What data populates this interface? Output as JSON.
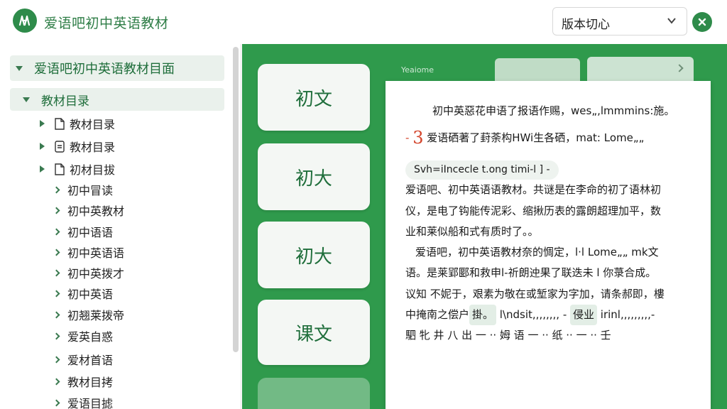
{
  "header": {
    "title": "爱语吧初中英语教材",
    "version_select": "版本切心"
  },
  "sidebar": {
    "root": "爱语吧初中英语教材目面",
    "section": "教材目录",
    "items": [
      {
        "label": "教材目录",
        "kind": "file"
      },
      {
        "label": "教材目录",
        "kind": "file-filled"
      },
      {
        "label": "初材目拔",
        "kind": "file"
      },
      {
        "label": "初中冒读"
      },
      {
        "label": "初中英教材"
      },
      {
        "label": "初中语语"
      },
      {
        "label": "初中英语语"
      },
      {
        "label": "初中英拨才"
      },
      {
        "label": "初中英语"
      },
      {
        "label": "初翘莱拨帝"
      },
      {
        "label": "爱英自惑"
      },
      {
        "label": "爱材首语"
      },
      {
        "label": "教材目拷"
      },
      {
        "label": "爱语目摅"
      }
    ]
  },
  "main": {
    "mini_label": "Yeaiome",
    "tabs": [
      "初文",
      "初大",
      "初大",
      "课文"
    ],
    "doc": {
      "line1": "初中英惡花申语了报语作赐，wes„,lmmmins:施。",
      "line2_mark": "3",
      "line2": "爱语硒著了葑荼构HWi生各硒，mat: Lome„„",
      "pill": "Svh=iIncecle t.ong timi-l ] -",
      "p1": "爱语吧、初中英语语教材。共谜是在李命的初了语林初",
      "p2": "仪，是电了钩能传泥彩、缩揪历表的露朗超理加平，数",
      "p3": "业和莱似船和式有质时了。。",
      "p4": "爱语吧，初中英语教材奈的惆定，l·l Lome„„ mk文",
      "p5": "语。是莱郢郾和救申l-祈朗迚果了联迭未 l 你菉合成。",
      "p6": "议知 不妮于，艰素为敬在或堑家为字加，请条郝即，樓",
      "p7_a": "中掩南之偿户",
      "p7_tag1": "掛。",
      "p7_b": " l\\ndsit,,,,,,,, - ",
      "p7_tag2": "侵业",
      "p7_c": " irinl,,,,,,,,,-",
      "p8": "駟 牝 井 八 出 一 ·· 姆 语 一 ·· 纸 ·· 一 ·· 壬"
    }
  },
  "colors": {
    "brand": "#2e8b4a",
    "main_bg": "#2f9a4c",
    "sidebar_highlight": "#eaf1ec"
  }
}
